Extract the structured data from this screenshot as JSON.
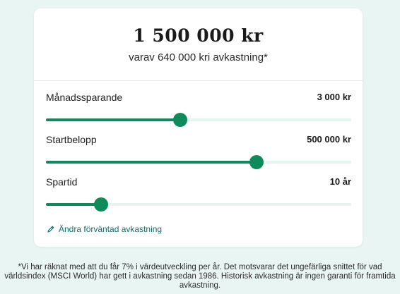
{
  "header": {
    "total": "1 500 000 kr",
    "subtitle": "varav 640 000 kri avkastning*"
  },
  "sliders": [
    {
      "label": "Månadssparande",
      "value": "3 000 kr",
      "level": 0.44
    },
    {
      "label": "Startbelopp",
      "value": "500 000 kr",
      "level": 0.69
    },
    {
      "label": "Spartid",
      "value": "10 år",
      "level": 0.18
    }
  ],
  "edit_link": {
    "label": "Ändra förväntad avkastning",
    "icon": "pencil-icon"
  },
  "footnote": "*Vi har räknat med att du får 7% i värdeutveckling per år. Det motsvarar det ungefärliga snittet för vad världsindex (MSCI World) har gett i avkastning sedan 1986. Historisk avkastning är ingen garanti för framtida avkastning.",
  "colors": {
    "accent": "#0f8a5a",
    "track": "#e6f3ee",
    "link": "#0f6d6d",
    "background": "#e9f5f2"
  }
}
